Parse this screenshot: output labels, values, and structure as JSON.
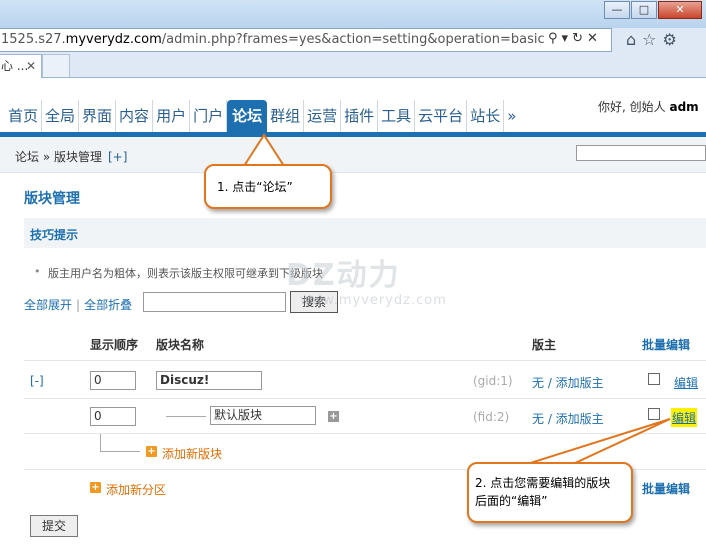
{
  "browser": {
    "url_host_prefix": "1525.s27.",
    "url_host_main": "myverydz.com",
    "url_path": "/admin.php?frames=yes&action=setting&operation=basic",
    "tab_title": "心 ...",
    "window_buttons": [
      "minimize-icon",
      "restore-icon",
      "close-icon"
    ]
  },
  "nav": {
    "items": [
      "首页",
      "全局",
      "界面",
      "内容",
      "用户",
      "门户",
      "论坛",
      "群组",
      "运营",
      "插件",
      "工具",
      "云平台",
      "站长",
      "»"
    ],
    "active": "论坛",
    "greeting_prefix": "你好, 创始人",
    "greeting_user": "adm"
  },
  "breadcrumb": {
    "path": "论坛 » 版块管理",
    "plus": "[+]"
  },
  "page": {
    "title": "版块管理",
    "tips_title": "技巧提示",
    "tip_text": "版主用户名为粗体，则表示该版主权限可继承到下级版块",
    "expand_all": "全部展开",
    "separator": "|",
    "collapse_all": "全部折叠",
    "search_button": "搜索"
  },
  "table": {
    "headers": {
      "order": "显示顺序",
      "name": "版块名称",
      "moderator": "版主",
      "batch_edit": "批量编辑"
    },
    "rows": [
      {
        "toggle": "[-]",
        "order": "0",
        "name": "Discuz!",
        "id": "(gid:1)",
        "moderator": "无 / 添加版主",
        "edit": "编辑"
      },
      {
        "order": "0",
        "name": "默认版块",
        "id": "(fid:2)",
        "moderator": "无 / 添加版主",
        "edit": "编辑"
      }
    ],
    "add_forum": "添加新版块",
    "add_category": "添加新分区",
    "batch_edit_bottom": "批量编辑"
  },
  "submit_label": "提交",
  "watermark": {
    "main": "DZ动力",
    "sub": "www.myverydz.com"
  },
  "callouts": {
    "step1": "1. 点击“论坛”",
    "step2_line1": "2. 点击您需要编辑的版块",
    "step2_line2": "后面的“编辑”"
  },
  "colors": {
    "accent": "#1d6fb0",
    "callout_border": "#e1761e",
    "highlight": "#fff200",
    "add_link": "#e06d00"
  }
}
